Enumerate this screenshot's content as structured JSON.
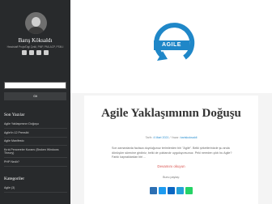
{
  "sidebar": {
    "name": "Barış Köksaldı",
    "description": "Headstaff Proje/Digi Çekil, PMP, PMI-ACP, PSM-I",
    "socials": [
      "facebook-icon",
      "linkedin-icon",
      "instagram-icon",
      "mail-icon"
    ],
    "search": {
      "button_label": "Git"
    },
    "recent": {
      "heading": "Son Yazılar",
      "items": [
        "Agile Yaklaşımının Doğuşu",
        "Agile'in 12 Prensibi",
        "Agile Manifesto",
        "Kırık Pencereler Kuramı (Broken Windows Theory)",
        "PHP Nedir?"
      ]
    },
    "categories": {
      "heading": "Kategoriler",
      "items": [
        "Agile (3)"
      ]
    }
  },
  "hero": {
    "logo_text": "AGILE"
  },
  "post": {
    "title": "Agile Yaklaşımının Doğuşu",
    "meta_date_label": "Tarih: ",
    "date": "4 Mart 2021",
    "meta_author_label": " / Yazar: ",
    "author": "bariskoksaldi",
    "excerpt": "Son zamanlarda fazlaca duyduğunuz terimlerden biri \"Agile\". Belki şirketlerinizde şu anda dönüşüm sürecine girdiniz, belki de çoktandır uyguluyorsunuz. Peki nereden çıktı bu Agile? Farklı kaynaklardan biri ...",
    "read_more": "Devamını okuyun",
    "share_label": "Bunu paylaş:"
  },
  "colors": {
    "sidebar_bg": "#282a2c",
    "accent_blue": "#1f87c8",
    "read_more": "#d9534f"
  }
}
